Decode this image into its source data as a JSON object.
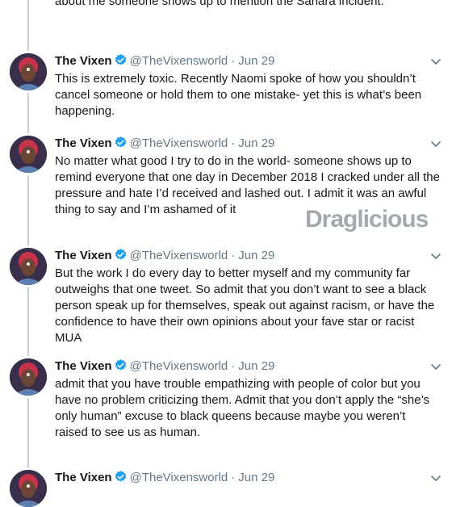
{
  "thread_top_text": "about me someone shows up to mention the Sahara incident.",
  "tweets": [
    {
      "name": "The Vixen",
      "handle": "@TheVixensworld",
      "separator": "·",
      "date": "Jun 29",
      "text": "This is extremely toxic. Recently Naomi spoke of how you shouldn’t cancel someone or hold them to one mistake- yet this is what’s been happening."
    },
    {
      "name": "The Vixen",
      "handle": "@TheVixensworld",
      "separator": "·",
      "date": "Jun 29",
      "text": "No matter what good I try to do in the world- someone shows up to remind everyone that one day in December 2018 I cracked under all the pressure and hate I’d received and lashed out. I admit it was an awful thing to say and I’m ashamed of it"
    },
    {
      "name": "The Vixen",
      "handle": "@TheVixensworld",
      "separator": "·",
      "date": "Jun 29",
      "text": "But the work I do every day to better myself and my community far outweighs that one tweet. So admit that you don’t want to see a black person speak up for themselves, speak out against racism, or have the confidence to have their own opinions about your fave star or racist MUA"
    },
    {
      "name": "The Vixen",
      "handle": "@TheVixensworld",
      "separator": "·",
      "date": "Jun 29",
      "text": "admit that you have trouble empathizing with people of color but you have no problem criticizing them. Admit that you don’t apply the “she’s only human” excuse to black queens because maybe you weren’t raised to see us as human."
    },
    {
      "name": "The Vixen",
      "handle": "@TheVixensworld",
      "separator": "·",
      "date": "Jun 29",
      "text": ""
    }
  ],
  "watermark": "Draglicious",
  "colors": {
    "text": "#14171a",
    "meta": "#657786",
    "verified": "#1da1f2",
    "thread_line": "#c4cfd6"
  },
  "icons": {
    "verified": "verified-badge-icon",
    "menu": "chevron-down-icon"
  }
}
